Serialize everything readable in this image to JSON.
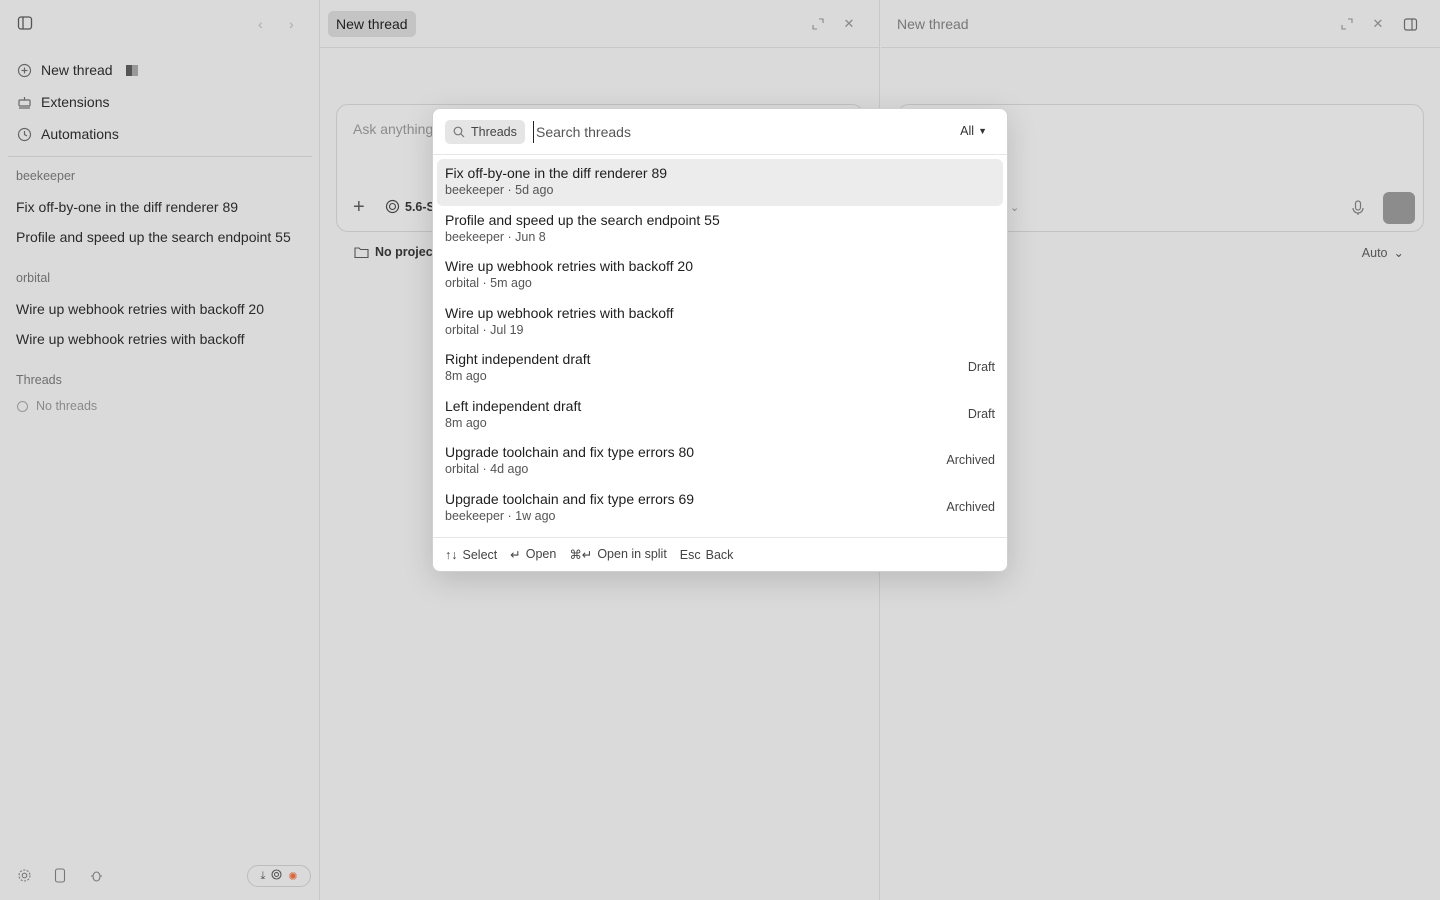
{
  "sidebar": {
    "menu": [
      {
        "label": "New thread",
        "icon": "new-thread-icon"
      },
      {
        "label": "Extensions",
        "icon": "extensions-icon"
      },
      {
        "label": "Automations",
        "icon": "clock-icon"
      }
    ],
    "groups": [
      {
        "title": "beekeeper",
        "threads": [
          "Fix off-by-one in the diff renderer 89",
          "Profile and speed up the search endpoint 55"
        ]
      },
      {
        "title": "orbital",
        "threads": [
          "Wire up webhook retries with backoff 20",
          "Wire up webhook retries with backoff"
        ]
      }
    ],
    "threads_section_title": "Threads",
    "no_threads_label": "No threads"
  },
  "left_pane": {
    "tab_label": "New thread",
    "composer_placeholder": "Ask anything",
    "model_label": "5.6-S",
    "project_label": "No project"
  },
  "right_pane": {
    "tab_label": "New thread",
    "mode_label": "Auto"
  },
  "modal": {
    "scope_label": "Threads",
    "search_placeholder": "Search threads",
    "filter_label": "All",
    "results": [
      {
        "title": "Fix off-by-one in the diff renderer 89",
        "meta": "beekeeper · 5d ago",
        "badge": ""
      },
      {
        "title": "Profile and speed up the search endpoint 55",
        "meta": "beekeeper · Jun 8",
        "badge": ""
      },
      {
        "title": "Wire up webhook retries with backoff 20",
        "meta": "orbital · 5m ago",
        "badge": ""
      },
      {
        "title": "Wire up webhook retries with backoff",
        "meta": "orbital · Jul 19",
        "badge": ""
      },
      {
        "title": "Right independent draft",
        "meta": "8m ago",
        "badge": "Draft"
      },
      {
        "title": "Left independent draft",
        "meta": "8m ago",
        "badge": "Draft"
      },
      {
        "title": "Upgrade toolchain and fix type errors 80",
        "meta": "orbital · 4d ago",
        "badge": "Archived"
      },
      {
        "title": "Upgrade toolchain and fix type errors 69",
        "meta": "beekeeper · 1w ago",
        "badge": "Archived"
      }
    ],
    "footer_hints": [
      {
        "keys": "↑↓",
        "action": "Select"
      },
      {
        "keys": "↵",
        "action": "Open"
      },
      {
        "keys": "⌘↵",
        "action": "Open in split"
      },
      {
        "keys": "Esc",
        "action": "Back"
      }
    ]
  },
  "colors": {
    "background": "#dadada",
    "modal_background": "#ffffff",
    "selected_row": "#ececec",
    "send_button": "#8c8c8c"
  }
}
